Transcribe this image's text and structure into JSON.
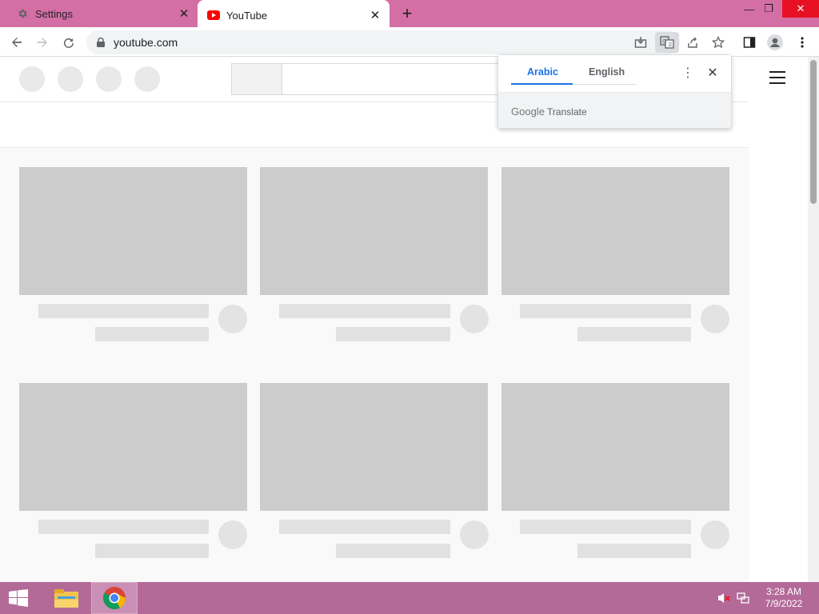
{
  "browser": {
    "tabs": [
      {
        "title": "Settings",
        "icon": "gear-icon",
        "active": false
      },
      {
        "title": "YouTube",
        "icon": "youtube-icon",
        "active": true
      }
    ],
    "new_tab_label": "+",
    "address": "youtube.com",
    "colors": {
      "titlebar": "#d46fa5",
      "taskbar": "#b46a98"
    }
  },
  "translate_popup": {
    "tabs": [
      "Arabic",
      "English"
    ],
    "selected": "Arabic",
    "brand_google": "Google",
    "brand_translate": "Translate"
  },
  "taskbar": {
    "time": "3:28 AM",
    "date": "7/9/2022"
  }
}
